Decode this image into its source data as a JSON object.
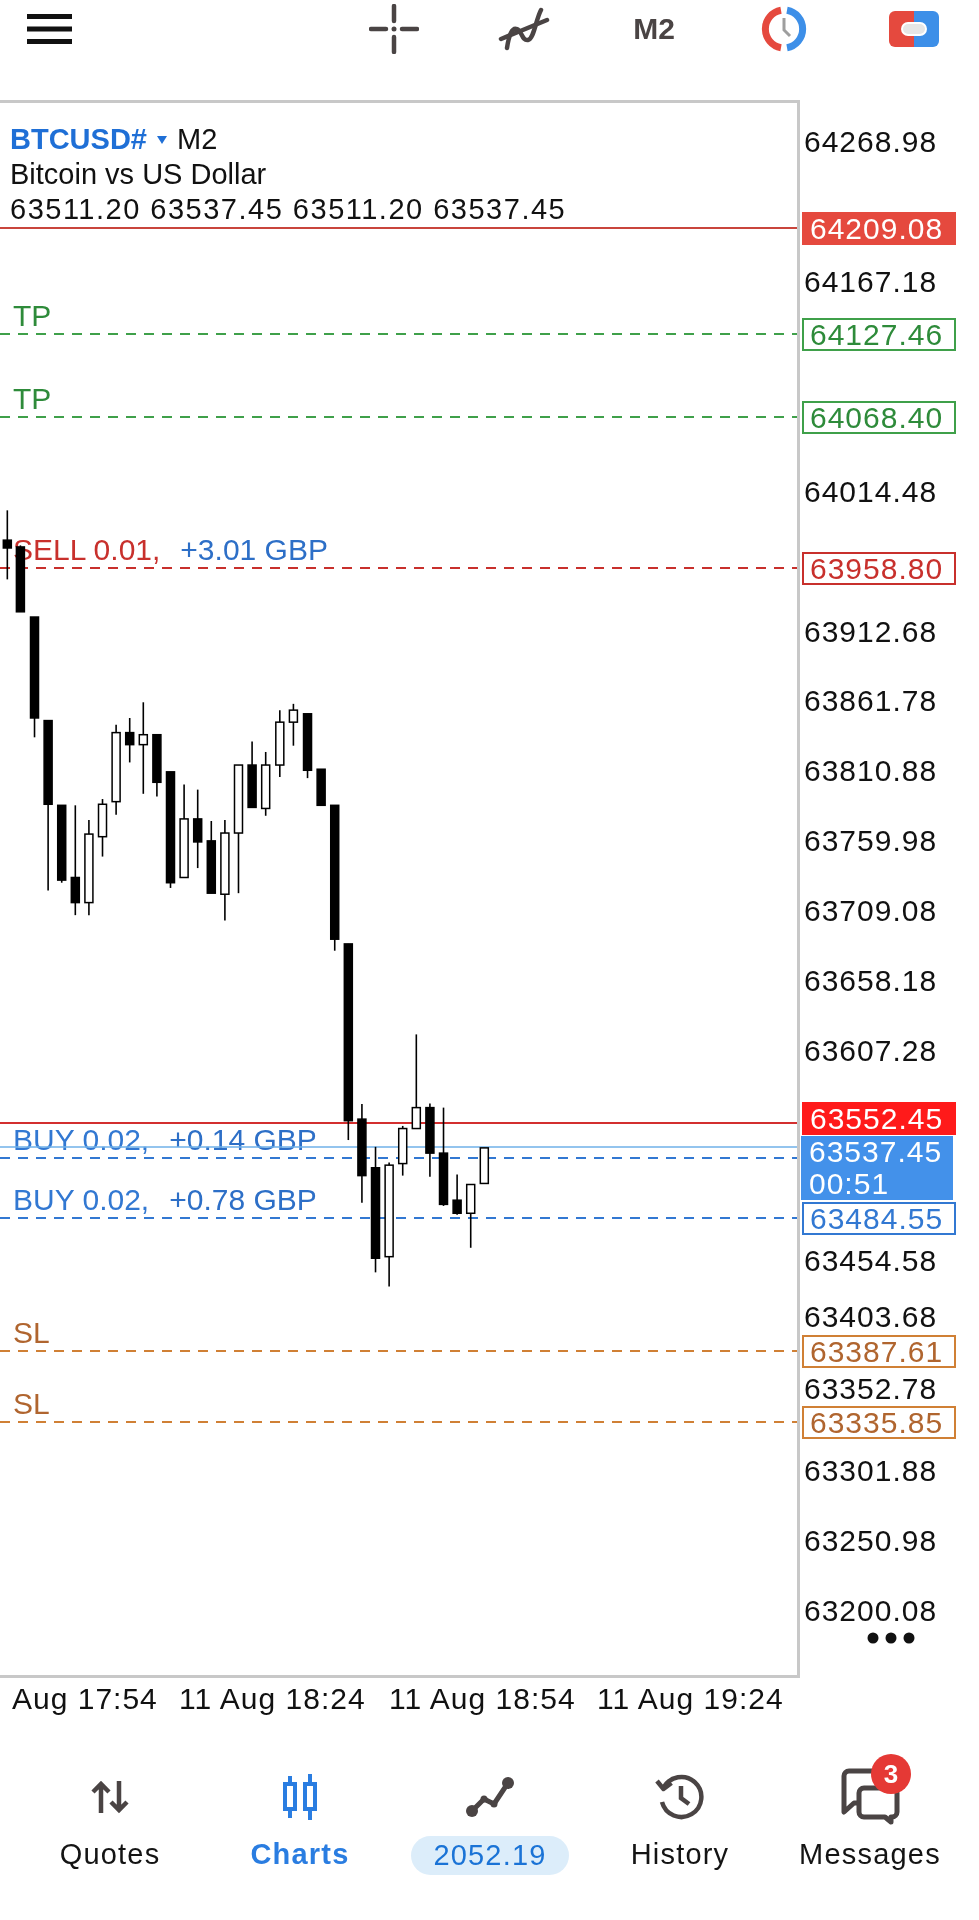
{
  "toolbar": {
    "timeframe": "M2"
  },
  "chart": {
    "symbol": "BTCUSD#",
    "period": "M2",
    "description": "Bitcoin vs US Dollar",
    "ohlc": "63511.20 63537.45 63511.20 63537.45",
    "price_axis": [
      "64268.98",
      "64167.18",
      "64014.48",
      "63912.68",
      "63861.78",
      "63810.88",
      "63759.98",
      "63709.08",
      "63658.18",
      "63607.28",
      "63454.58",
      "63403.68",
      "63352.78",
      "63301.88",
      "63250.98",
      "63200.08"
    ],
    "levels": [
      {
        "kind": "line",
        "price": "64209.08"
      },
      {
        "kind": "take_profit",
        "label": "TP",
        "price": "64127.46"
      },
      {
        "kind": "take_profit",
        "label": "TP",
        "price": "64068.40"
      },
      {
        "kind": "order",
        "color": "#c8302c",
        "side": "SELL 0.01,",
        "profit": "+3.01 GBP",
        "price": "63958.80"
      },
      {
        "kind": "ask",
        "price": "63552.45"
      },
      {
        "kind": "order",
        "color": "#3278d2",
        "side": "BUY 0.02,",
        "profit": "+0.14 GBP"
      },
      {
        "kind": "bid",
        "price": "63537.45",
        "countdown": "00:51"
      },
      {
        "kind": "order",
        "color": "#3278d2",
        "side": "BUY 0.02,",
        "profit": "+0.78 GBP",
        "price": "63484.55"
      },
      {
        "kind": "stop_loss",
        "label": "SL",
        "price": "63387.61"
      },
      {
        "kind": "stop_loss",
        "label": "SL",
        "price": "63335.85"
      }
    ],
    "time_axis": [
      "Aug 17:54",
      "11 Aug 18:24",
      "11 Aug 18:54",
      "11 Aug 19:24"
    ]
  },
  "nav": [
    {
      "kind": "tab",
      "label": "Quotes",
      "selected": false
    },
    {
      "kind": "tab",
      "label": "Charts",
      "selected": true
    },
    {
      "kind": "balance",
      "label": "2052.19",
      "selected": false
    },
    {
      "kind": "tab",
      "label": "History",
      "selected": false
    },
    {
      "kind": "tab",
      "label": "Messages",
      "selected": false,
      "badge": "3"
    }
  ]
}
